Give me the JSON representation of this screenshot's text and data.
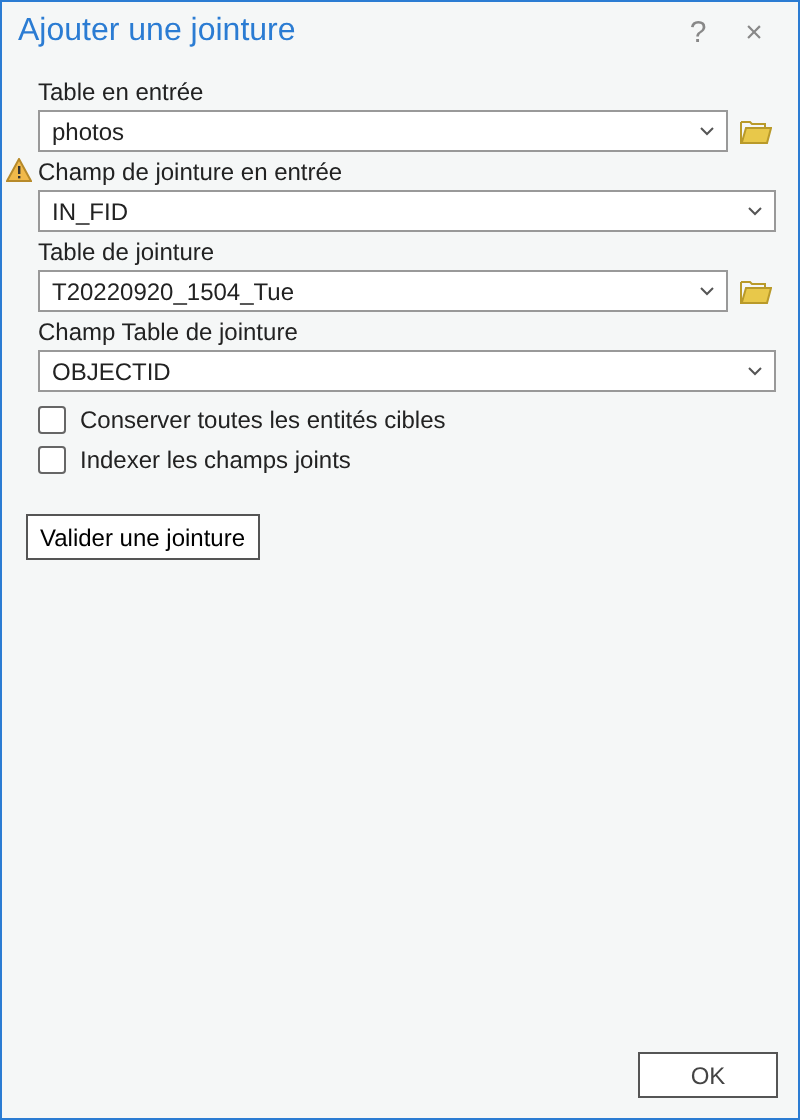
{
  "window": {
    "title": "Ajouter une jointure",
    "help": "?",
    "close": "×"
  },
  "fields": [
    {
      "label": "Table en entrée",
      "value": "photos",
      "warning": false,
      "browse": true
    },
    {
      "label": "Champ de jointure en entrée",
      "value": "IN_FID",
      "warning": true,
      "browse": false
    },
    {
      "label": "Table de jointure",
      "value": "T20220920_1504_Tue",
      "warning": false,
      "browse": true
    },
    {
      "label": "Champ Table de jointure",
      "value": "OBJECTID",
      "warning": false,
      "browse": false
    }
  ],
  "checkboxes": [
    {
      "label": "Conserver toutes les entités cibles",
      "checked": false
    },
    {
      "label": "Indexer les champs joints",
      "checked": false
    }
  ],
  "validate_button": "Valider une jointure",
  "ok_button": "OK"
}
